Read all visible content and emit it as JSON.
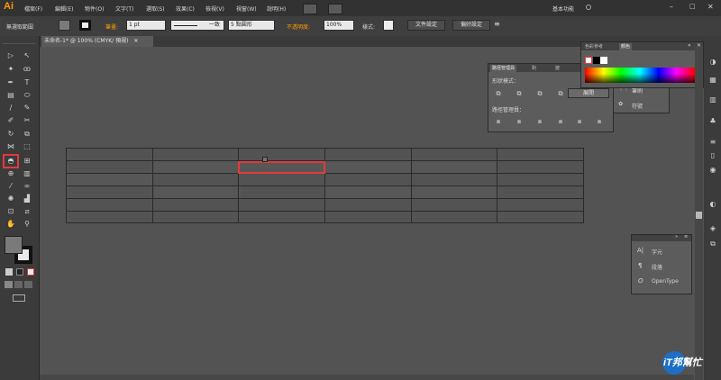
{
  "app": {
    "logo": "Ai"
  },
  "menu": [
    "檔案(F)",
    "編輯(E)",
    "物件(O)",
    "文字(T)",
    "選取(S)",
    "效果(C)",
    "檢視(V)",
    "視窗(W)",
    "說明(H)"
  ],
  "workspace": {
    "label": "基本功能"
  },
  "control_bar": {
    "selection_label": "無選取範圍",
    "stroke_label": "筆畫:",
    "stroke_value": "1 pt",
    "stroke_profile": "一致",
    "brush": "5 點圓形",
    "opacity_label": "不透明度:",
    "opacity_value": "100%",
    "style_label": "樣式:",
    "doc_setup_button": "文件設定",
    "prefs_button": "偏好設定"
  },
  "document_tab": {
    "title": "未命名-1* @ 100% (CMYK/ 預視)"
  },
  "pathfinder_panel": {
    "tabs": [
      "路徑管理員",
      "對",
      "變"
    ],
    "shape_modes_label": "形狀模式：",
    "expand_button": "展開",
    "pathfinders_label": "路徑管理員："
  },
  "color_panel": {
    "tabs": [
      "色彩參考",
      "顏色"
    ],
    "behind_items": [
      "筆刷",
      "符號"
    ]
  },
  "char_panel": {
    "items": [
      {
        "icon": "A|",
        "label": "字元"
      },
      {
        "icon": "¶",
        "label": "段落"
      },
      {
        "icon": "O",
        "label": "OpenType"
      }
    ]
  },
  "watermark": {
    "text": "iT邦幫忙"
  },
  "colors": {
    "menubar": "#323232",
    "canvas": "#535353",
    "selection_red": "#e23a3a",
    "ai_orange": "#ff9a00"
  }
}
